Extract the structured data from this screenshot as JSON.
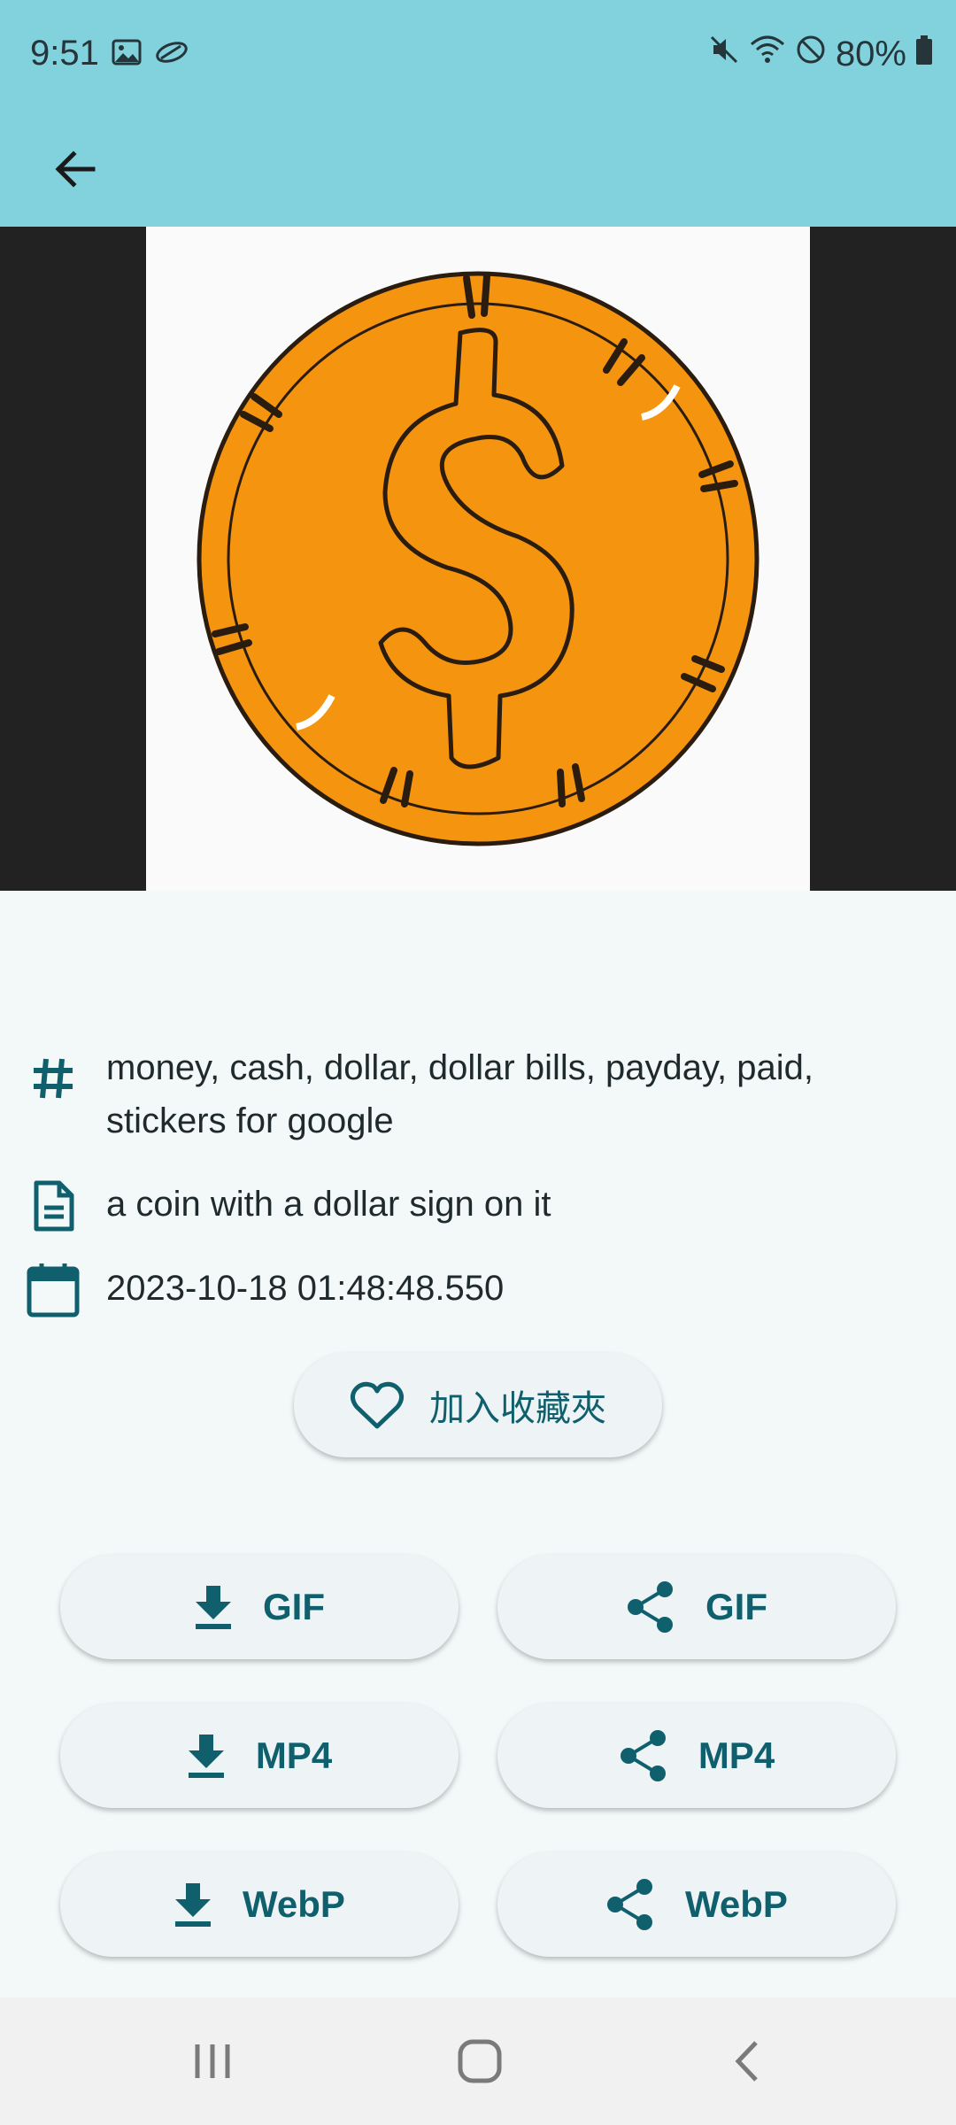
{
  "status": {
    "time": "9:51",
    "battery": "80%",
    "left_icons": [
      "image-icon",
      "app-notification-icon"
    ],
    "right_icons": [
      "mute-icon",
      "wifi-icon",
      "dnd-icon",
      "battery-icon"
    ]
  },
  "app_bar": {
    "back_icon": "arrow-left-icon"
  },
  "media": {
    "description": "orange coin sticker with dollar sign"
  },
  "info": {
    "tags": "money, cash, dollar, dollar bills, payday, paid, stickers for google",
    "description": "a coin with a dollar sign on it",
    "date": "2023-10-18 01:48:48.550"
  },
  "favorite": {
    "label": "加入收藏夾",
    "icon": "heart-outline-icon"
  },
  "actions": [
    {
      "type": "download",
      "label": "GIF"
    },
    {
      "type": "share",
      "label": "GIF"
    },
    {
      "type": "download",
      "label": "MP4"
    },
    {
      "type": "share",
      "label": "MP4"
    },
    {
      "type": "download",
      "label": "WebP"
    },
    {
      "type": "share",
      "label": "WebP"
    }
  ],
  "colors": {
    "app_bar": "#82d2de",
    "accent": "#0f5f6d",
    "coin": "#f5940f",
    "background": "#f3f8f9"
  }
}
